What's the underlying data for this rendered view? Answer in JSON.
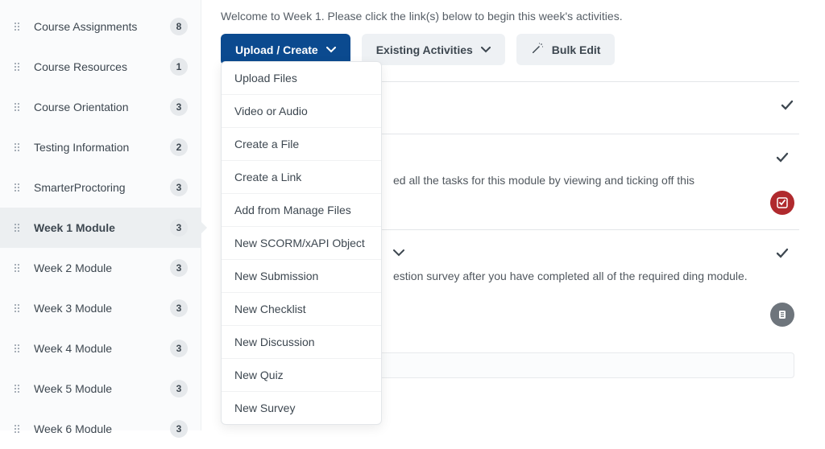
{
  "sidebar": {
    "items": [
      {
        "label": "Course Assignments",
        "count": "8",
        "active": false
      },
      {
        "label": "Course Resources",
        "count": "1",
        "active": false
      },
      {
        "label": "Course Orientation",
        "count": "3",
        "active": false
      },
      {
        "label": "Testing Information",
        "count": "2",
        "active": false
      },
      {
        "label": "SmarterProctoring",
        "count": "3",
        "active": false
      },
      {
        "label": "Week 1 Module",
        "count": "3",
        "active": true
      },
      {
        "label": "Week 2 Module",
        "count": "3",
        "active": false
      },
      {
        "label": "Week 3 Module",
        "count": "3",
        "active": false
      },
      {
        "label": "Week 4 Module",
        "count": "3",
        "active": false
      },
      {
        "label": "Week 5 Module",
        "count": "3",
        "active": false
      },
      {
        "label": "Week 6 Module",
        "count": "3",
        "active": false
      }
    ]
  },
  "welcome_text": "Welcome to Week 1. Please click the link(s) below to begin this week's activities.",
  "toolbar": {
    "upload_create": "Upload / Create",
    "existing_activities": "Existing Activities",
    "bulk_edit": "Bulk Edit"
  },
  "dropdown": {
    "open": true,
    "items": [
      "Upload Files",
      "Video or Audio",
      "Create a File",
      "Create a Link",
      "Add from Manage Files",
      "New SCORM/xAPI Object",
      "New Submission",
      "New Checklist",
      "New Discussion",
      "New Quiz",
      "New Survey"
    ]
  },
  "content": {
    "row1_text": "",
    "row2_text": "ed all the tasks for this module by viewing and ticking off this",
    "row3_text": "estion survey after you have completed all of the required ding module."
  }
}
